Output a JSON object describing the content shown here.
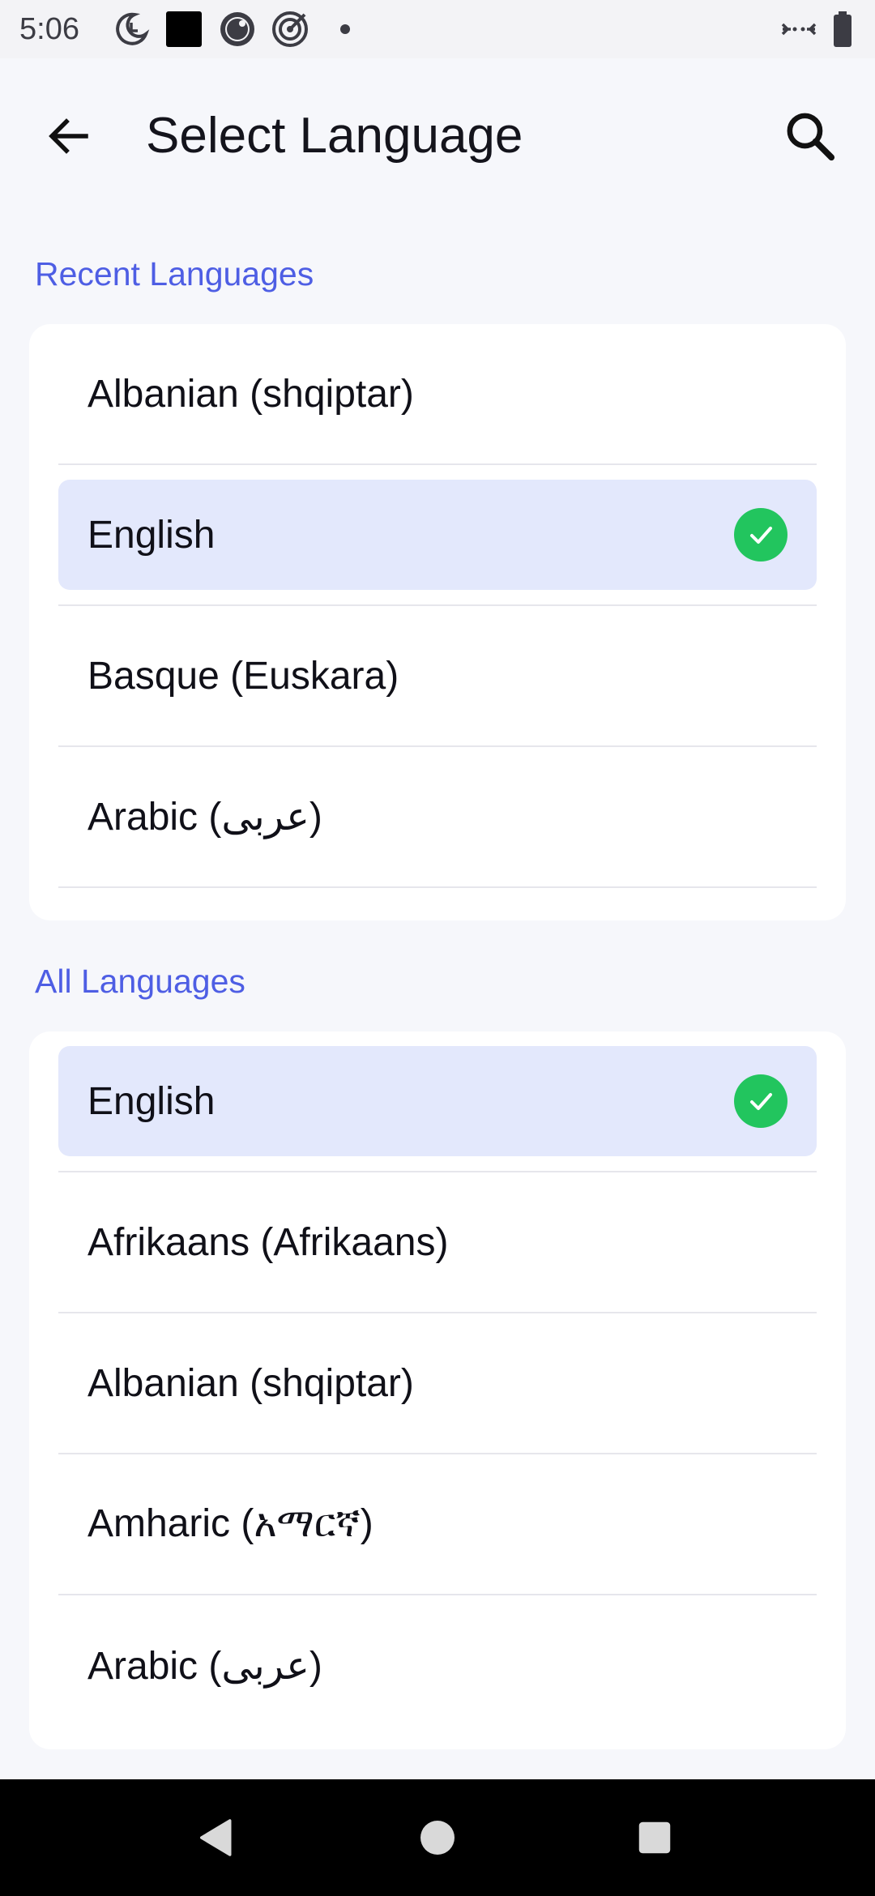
{
  "status_bar": {
    "time": "5:06",
    "left_icons": [
      "moon-clock-icon",
      "black-square-icon",
      "record-icon",
      "target-icon",
      "dot-icon"
    ],
    "right_icons": [
      "data-transfer-icon",
      "battery-icon"
    ]
  },
  "app_bar": {
    "title": "Select Language",
    "back_icon": "arrow-left-icon",
    "search_icon": "search-icon"
  },
  "recent": {
    "header": "Recent Languages",
    "items": [
      {
        "label": "Albanian (shqiptar)",
        "selected": false
      },
      {
        "label": "English",
        "selected": true
      },
      {
        "label": "Basque (Euskara)",
        "selected": false
      },
      {
        "label": "Arabic (عربى)",
        "selected": false
      }
    ]
  },
  "all": {
    "header": "All Languages",
    "items": [
      {
        "label": "English",
        "selected": true
      },
      {
        "label": "Afrikaans (Afrikaans)",
        "selected": false
      },
      {
        "label": "Albanian (shqiptar)",
        "selected": false
      },
      {
        "label": "Amharic (አማርኛ)",
        "selected": false
      },
      {
        "label": "Arabic (عربى)",
        "selected": false
      }
    ]
  },
  "colors": {
    "accent": "#4e5ee4",
    "selected_bg": "#e3e8fc",
    "check": "#22c55e"
  },
  "nav_bar": {
    "buttons": [
      "back-triangle-icon",
      "home-circle-icon",
      "recents-square-icon"
    ]
  }
}
